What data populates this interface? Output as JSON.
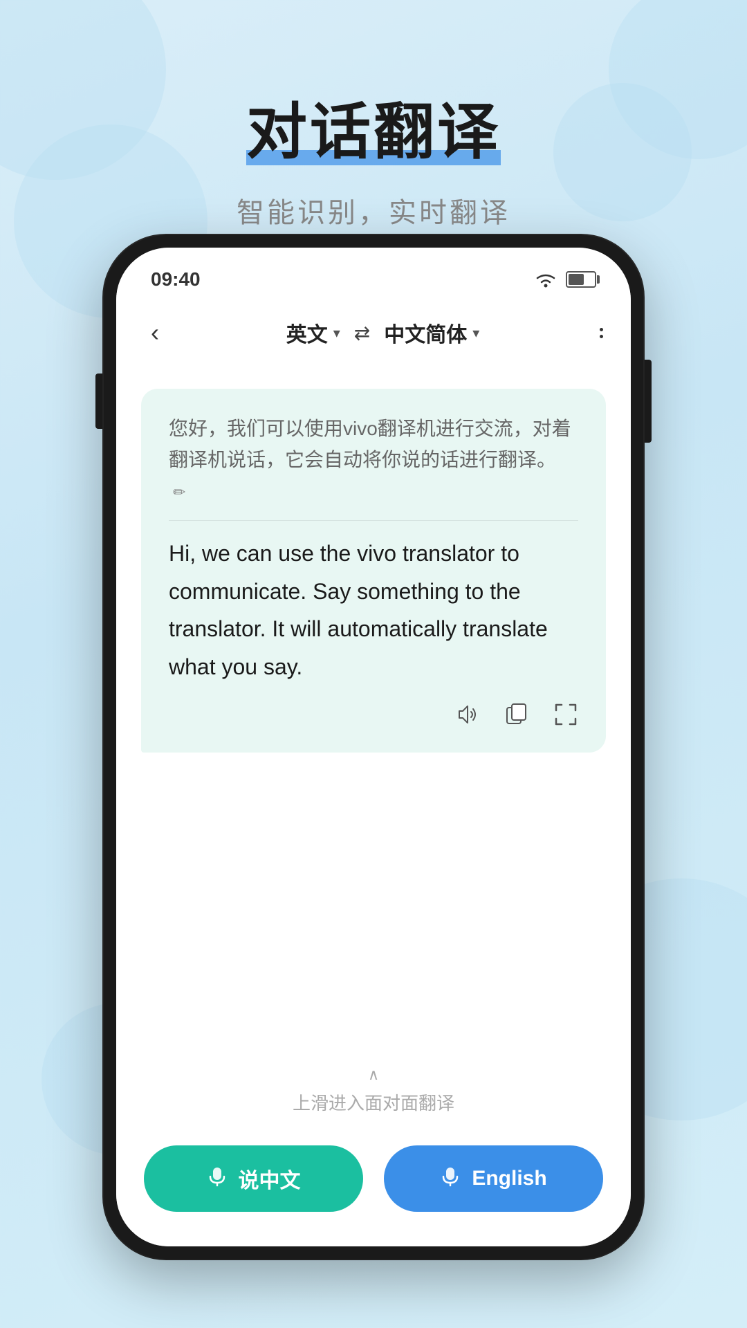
{
  "page": {
    "background": "#d4eef8"
  },
  "header": {
    "title": "对话翻译",
    "subtitle": "智能识别，实时翻译"
  },
  "status_bar": {
    "time": "09:40",
    "wifi_label": "wifi",
    "battery_label": "battery"
  },
  "nav": {
    "back_label": "‹",
    "source_lang": "英文",
    "source_chevron": "▾",
    "swap_icon": "⇄",
    "target_lang": "中文简体",
    "target_chevron": "▾",
    "more_dots": "···"
  },
  "message": {
    "original_text": "您好，我们可以使用vivo翻译机进行交流，对着翻译机说话，它会自动将你说的话进行翻译。",
    "edit_icon": "✏",
    "translated_text": "Hi, we can use the vivo translator to communicate. Say something to the translator. It will  automatically translate what you say."
  },
  "message_actions": {
    "volume_icon": "🔈",
    "copy_icon": "⧉",
    "expand_icon": "⛶"
  },
  "slide_hint": {
    "chevron": "∧",
    "label": "上滑进入面对面翻译"
  },
  "bottom_buttons": {
    "cn_label": "说中文",
    "en_label": "English",
    "mic_icon": "🎤"
  }
}
